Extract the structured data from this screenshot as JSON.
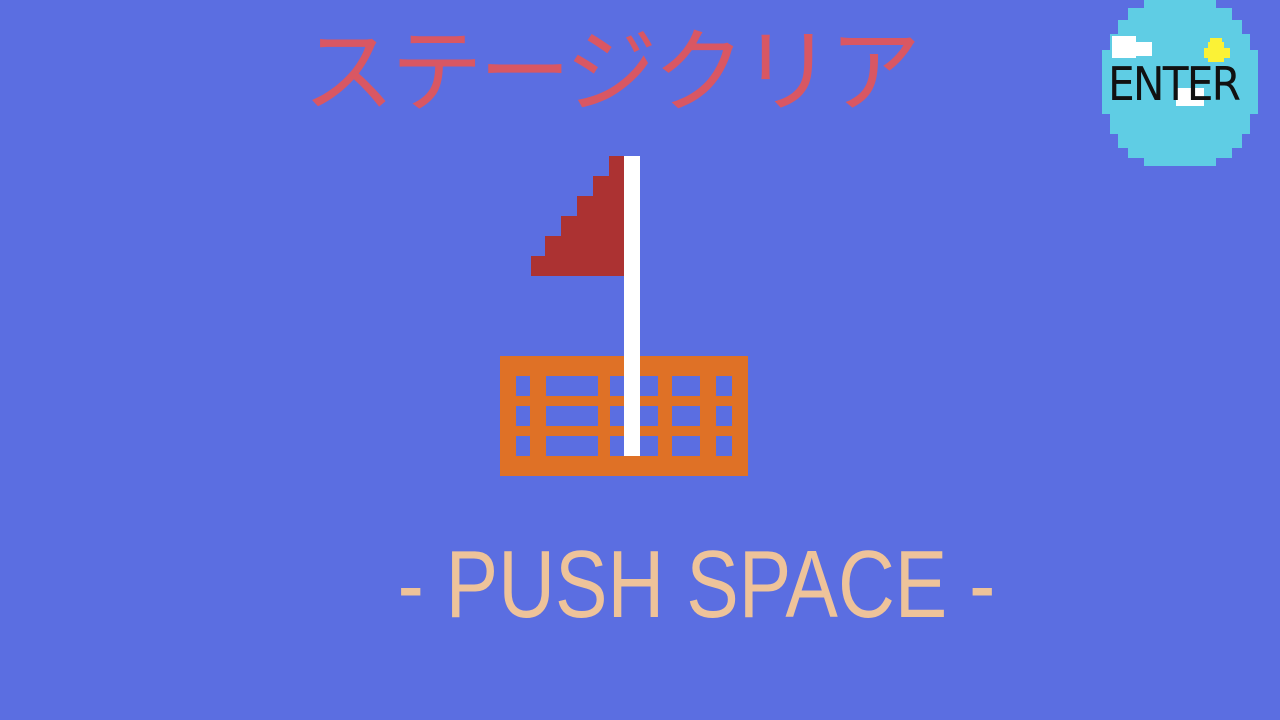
{
  "title": "ステージクリア",
  "prompt": "- PUSH SPACE -",
  "enter_button": {
    "label": "ENTER"
  },
  "colors": {
    "background": "#5b6ee1",
    "title": "#d95763",
    "prompt": "#eec39a",
    "flag": "#ac3232",
    "pole": "#ffffff",
    "crate": "#df7126",
    "enter_bg": "#5fcde4",
    "enter_sun": "#fbf236",
    "enter_cloud": "#ffffff"
  },
  "icons": {
    "goal": "goal-flag-icon",
    "enter": "enter-key-icon"
  }
}
